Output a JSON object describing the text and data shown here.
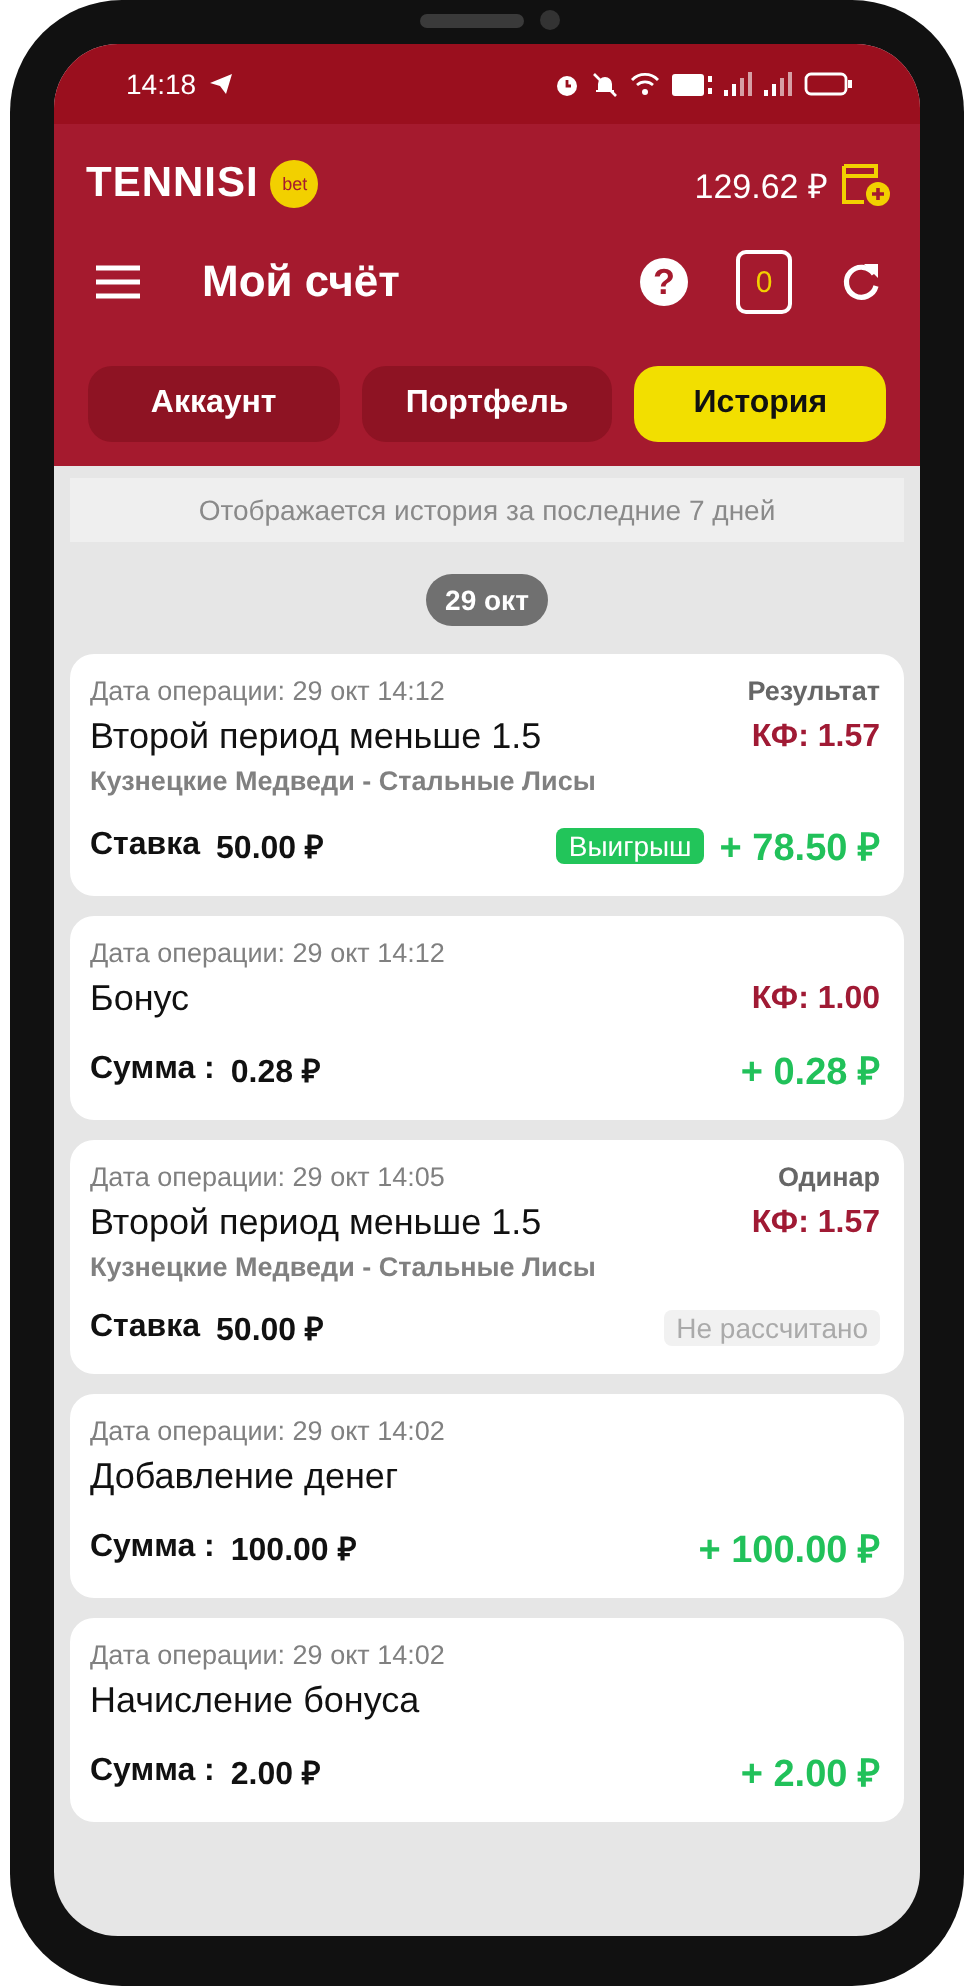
{
  "status_bar": {
    "time": "14:18"
  },
  "header": {
    "logo": "TENNISI",
    "logo_badge": "bet",
    "balance": "129.62 ₽"
  },
  "toolbar": {
    "title": "Мой счёт",
    "help": "?",
    "coupon_count": "0"
  },
  "tabs": [
    {
      "label": "Аккаунт",
      "selected": false
    },
    {
      "label": "Портфель",
      "selected": false
    },
    {
      "label": "История",
      "selected": true
    }
  ],
  "notice": "Отображается история за последние 7 дней",
  "date_group": "29 окт",
  "cards": [
    {
      "date": "Дата операции: 29 окт 14:12",
      "type": "Результат",
      "title": "Второй период меньше 1.5",
      "coef": "КФ: 1.57",
      "match": "Кузнецкие Медведи - Стальные Лисы",
      "amount_label": "Ставка",
      "amount": "50.00 ₽",
      "badge": {
        "text": "Выигрыш",
        "kind": "win"
      },
      "payout": "+ 78.50 ₽"
    },
    {
      "date": "Дата операции: 29 окт 14:12",
      "title": "Бонус",
      "coef": "КФ: 1.00",
      "amount_label": "Сумма :",
      "amount": "0.28 ₽",
      "payout": "+ 0.28 ₽"
    },
    {
      "date": "Дата операции: 29 окт 14:05",
      "type": "Одинар",
      "title": "Второй период меньше 1.5",
      "coef": "КФ: 1.57",
      "match": "Кузнецкие Медведи - Стальные Лисы",
      "amount_label": "Ставка",
      "amount": "50.00 ₽",
      "badge": {
        "text": "Не рассчитано",
        "kind": "pending"
      }
    },
    {
      "date": "Дата операции: 29 окт 14:02",
      "title": "Добавление денег",
      "amount_label": "Сумма :",
      "amount": "100.00 ₽",
      "payout": "+ 100.00 ₽"
    },
    {
      "date": "Дата операции: 29 окт 14:02",
      "title": "Начисление бонуса",
      "amount_label": "Сумма :",
      "amount": "2.00 ₽",
      "payout": "+ 2.00 ₽"
    }
  ]
}
